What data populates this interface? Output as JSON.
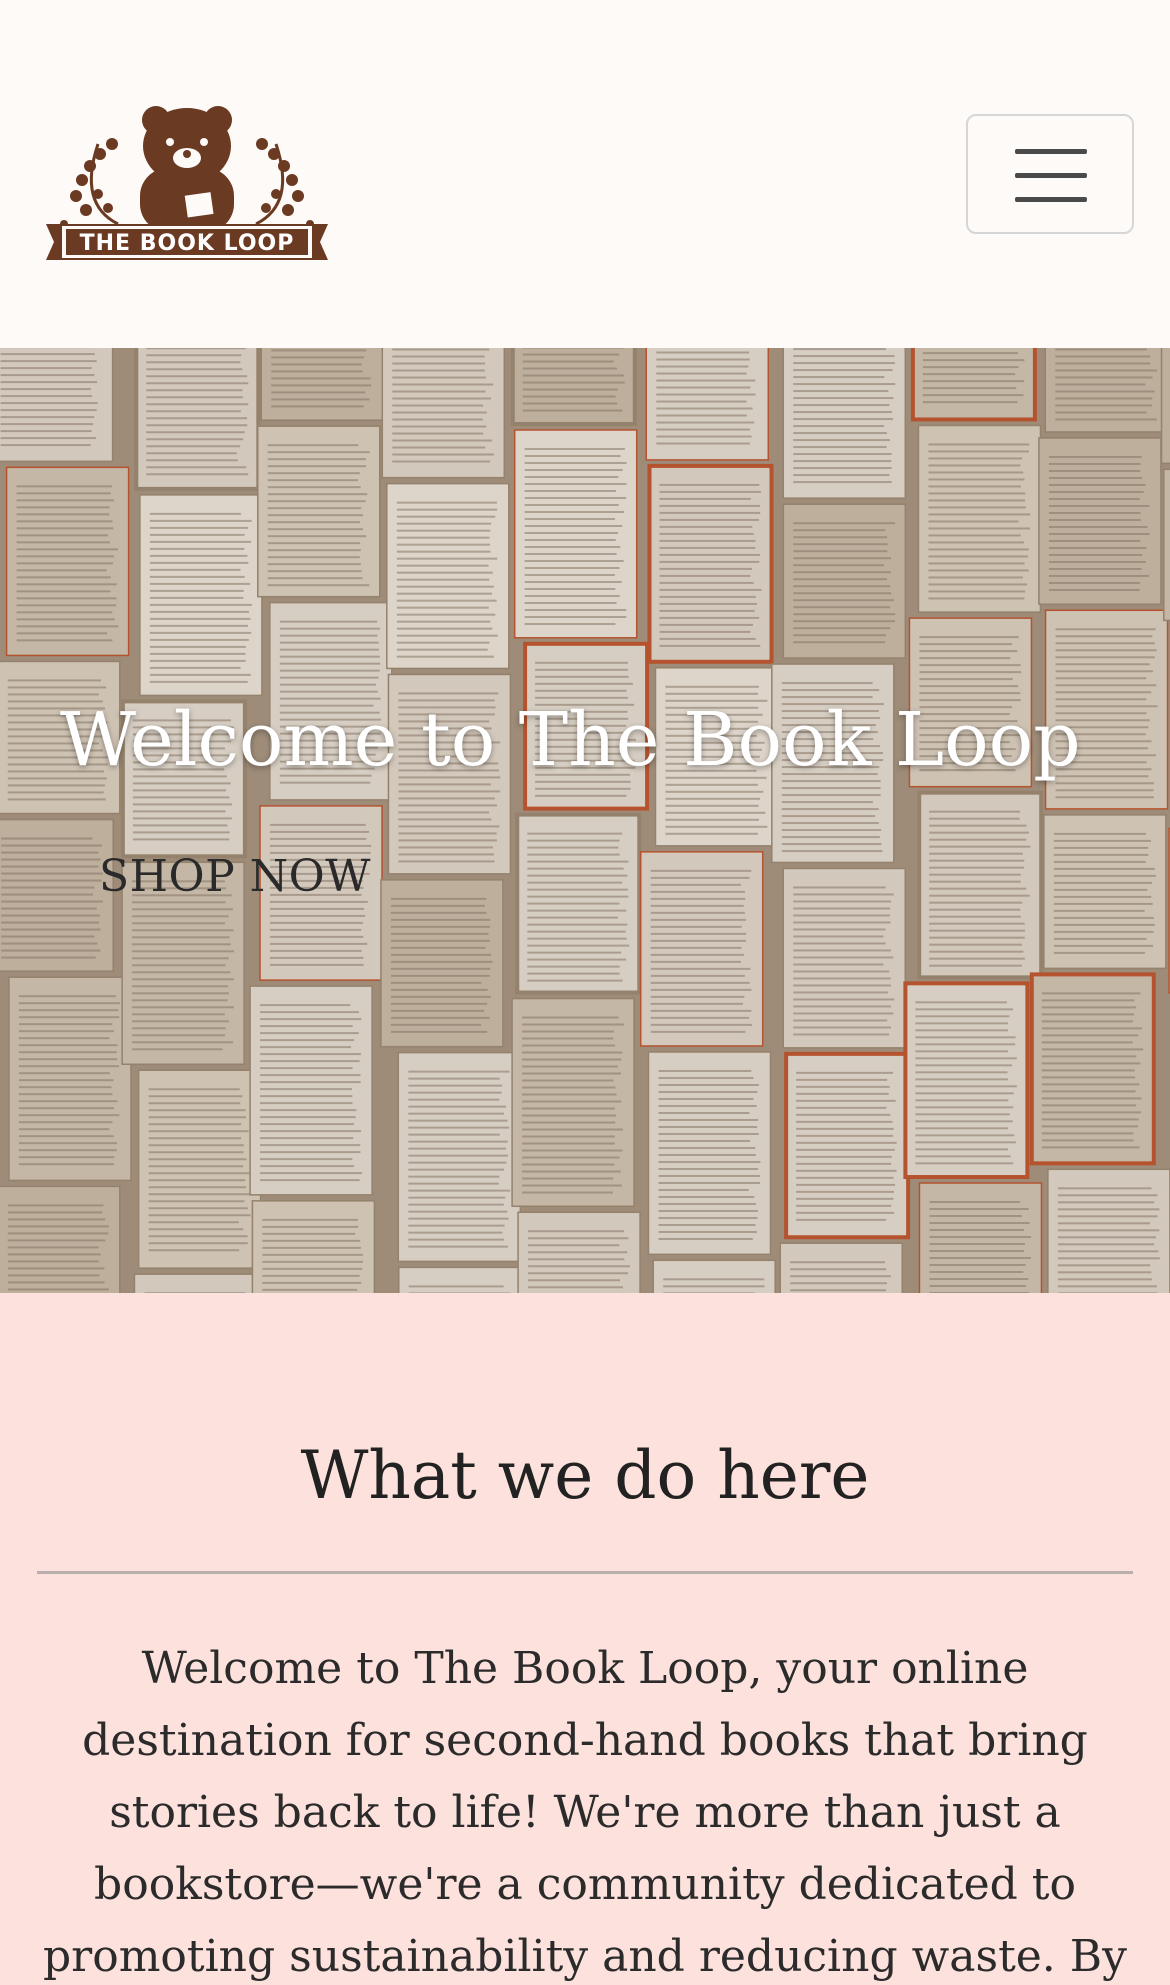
{
  "header": {
    "logo_text": "THE BOOK LOOP",
    "menu_icon": "hamburger-menu-icon"
  },
  "hero": {
    "title": "Welcome to The Book Loop",
    "cta_label": "SHOP NOW"
  },
  "about": {
    "title": "What we do here",
    "body": "Welcome to The Book Loop, your online destination for second-hand books that bring stories back to life! We're more than just a bookstore—we're a community dedicated to promoting sustainability and reducing waste. By"
  },
  "colors": {
    "logo_brown": "#6b3a22",
    "about_bg": "#fde1dc",
    "page_bg": "#fdfaf8"
  }
}
